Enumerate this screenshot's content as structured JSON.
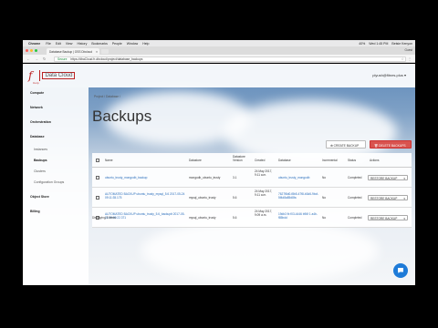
{
  "menubar": {
    "app": "Chrome",
    "items": [
      "File",
      "Edit",
      "View",
      "History",
      "Bookmarks",
      "People",
      "Window",
      "Help"
    ],
    "status": [
      "40%",
      "Wed 1:45 PM",
      "Betsie Kenyon"
    ]
  },
  "browser": {
    "tab_title": "Database Backup | OSS Dbcloud",
    "guest_label": "Guest",
    "secure_label": "Secure",
    "url": "https://dbaCloud.fr-dbcloud/project/database_backups"
  },
  "app": {
    "logo_mark": "f",
    "logo_corp": "Corp",
    "product_name": "Data Cloud",
    "user_label": "plyush@fitnes.plus ▾"
  },
  "sidebar": {
    "items": [
      {
        "label": "Compute",
        "type": "h"
      },
      {
        "label": "Network",
        "type": "h"
      },
      {
        "label": "Orchestration",
        "type": "h"
      },
      {
        "label": "Database",
        "type": "h"
      },
      {
        "label": "Instances",
        "type": "sub"
      },
      {
        "label": "Backups",
        "type": "active"
      },
      {
        "label": "Clusters",
        "type": "sub"
      },
      {
        "label": "Configuration Groups",
        "type": "sub"
      },
      {
        "label": "Object Store",
        "type": "h"
      },
      {
        "label": "Billing",
        "type": "h"
      }
    ]
  },
  "main": {
    "breadcrumb": "Project  /  Database  /",
    "title": "Backups",
    "create_button": "⊕ CREATE BACKUP",
    "delete_button": "🗑 DELETE BACKUPS",
    "columns": [
      "Name",
      "Datastore",
      "Datastore Version",
      "Created",
      "Database",
      "Incremental",
      "Status",
      "Actions"
    ],
    "rows": [
      {
        "name": "ubuntu_trusty_mongodb_backup",
        "datastore": "mongodb_ubuntu_trusty",
        "version": "3.1",
        "created": "24 May 2017, 9:11 a.m.",
        "database": "ubuntu_trusty_mongodb",
        "incremental": "No",
        "status": "Completed",
        "action": "RESTORE BACKUP"
      },
      {
        "name": "AUTOMATED BACKUP ubuntu_trusty_mysql_5.6 2017-05-24 09:11:35.175",
        "datastore": "mysql_ubuntu_trusty",
        "version": "5.6",
        "created": "24 May 2017, 9:11 a.m.",
        "database": "7627f8d0-f8b5-47f8-b3d6-9bcf-5f4d8a85d8fa",
        "incremental": "No",
        "status": "Completed",
        "action": "RESTORE BACKUP"
      },
      {
        "name": "AUTOMATED BACKUP ubuntu_trusty_5.6_backuptt 2017-05-24 09:09:22.371",
        "datastore": "mysql_ubuntu_trusty",
        "version": "5.6",
        "created": "24 May 2017, 9:09 a.m.",
        "database": "19db3 fb f03-4446 b96f 1 a4b-f85bdd",
        "incremental": "No",
        "status": "Completed",
        "action": "RESTORE BACKUP"
      }
    ],
    "footer": "Displaying 3 items"
  }
}
